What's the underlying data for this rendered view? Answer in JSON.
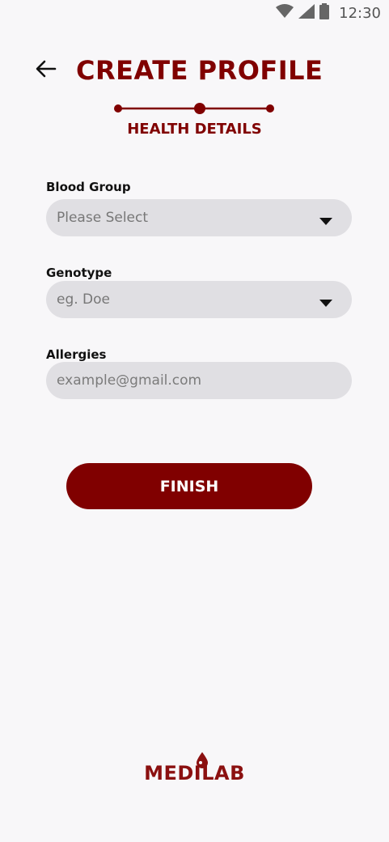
{
  "status_bar": {
    "time": "12:30",
    "icons": [
      "wifi-icon",
      "cellular-signal-icon",
      "battery-icon"
    ]
  },
  "header": {
    "back_icon": "arrow-left-icon",
    "title": "CREATE PROFILE"
  },
  "stepper": {
    "steps": 3,
    "current_step": 2,
    "subtitle": "HEALTH DETAILS"
  },
  "form": {
    "blood_group": {
      "label": "Blood Group",
      "placeholder": "Please Select",
      "icon": "dropdown-arrow-icon"
    },
    "genotype": {
      "label": "Genotype",
      "placeholder": "eg. Doe",
      "icon": "dropdown-arrow-icon"
    },
    "allergies": {
      "label": "Allergies",
      "placeholder": "example@gmail.com",
      "value": ""
    }
  },
  "actions": {
    "finish_label": "FINISH"
  },
  "logo": {
    "text": "MEDILAB"
  },
  "colors": {
    "brand": "#800000",
    "background": "#f8f7f9",
    "field_bg": "#e0dfe3"
  }
}
